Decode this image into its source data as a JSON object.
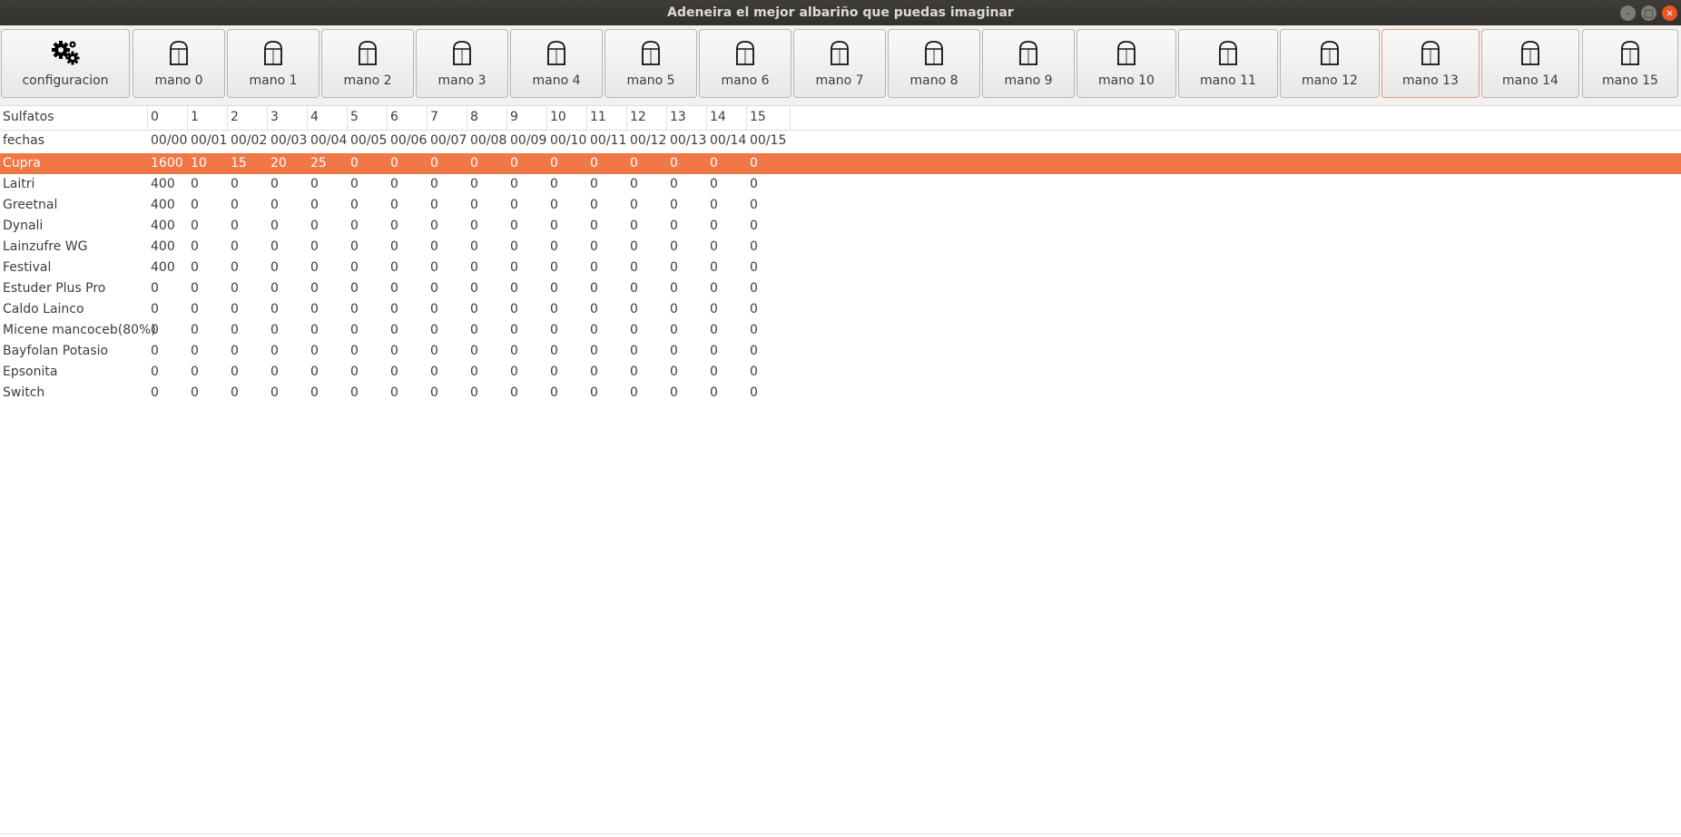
{
  "window": {
    "title": "Adeneira el mejor albariño que puedas imaginar",
    "minimize_glyph": "–",
    "maximize_glyph": "□",
    "close_glyph": "×"
  },
  "toolbar": {
    "config": {
      "label": "configuracion",
      "icon": "gears-icon"
    },
    "manos": [
      {
        "label": "mano 0"
      },
      {
        "label": "mano 1"
      },
      {
        "label": "mano 2"
      },
      {
        "label": "mano 3"
      },
      {
        "label": "mano 4"
      },
      {
        "label": "mano 5"
      },
      {
        "label": "mano 6"
      },
      {
        "label": "mano 7"
      },
      {
        "label": "mano 8"
      },
      {
        "label": "mano 9"
      },
      {
        "label": "mano 10"
      },
      {
        "label": "mano 11"
      },
      {
        "label": "mano 12"
      },
      {
        "label": "mano 13"
      },
      {
        "label": "mano 14"
      },
      {
        "label": "mano 15"
      }
    ],
    "mano_icon": "barn-door-icon",
    "highlighted_index": 13
  },
  "table": {
    "header_label": "Sulfatos",
    "columns": [
      "0",
      "1",
      "2",
      "3",
      "4",
      "5",
      "6",
      "7",
      "8",
      "9",
      "10",
      "11",
      "12",
      "13",
      "14",
      "15"
    ],
    "dates_label": "fechas",
    "dates": [
      "00/00",
      "00/01",
      "00/02",
      "00/03",
      "00/04",
      "00/05",
      "00/06",
      "00/07",
      "00/08",
      "00/09",
      "00/10",
      "00/11",
      "00/12",
      "00/13",
      "00/14",
      "00/15"
    ],
    "selected_row": 0,
    "selected_color": "#f07746",
    "rows": [
      {
        "name": "Cupra",
        "values": [
          "1600",
          "10",
          "15",
          "20",
          "25",
          "0",
          "0",
          "0",
          "0",
          "0",
          "0",
          "0",
          "0",
          "0",
          "0",
          "0"
        ]
      },
      {
        "name": "Laitri",
        "values": [
          "400",
          "0",
          "0",
          "0",
          "0",
          "0",
          "0",
          "0",
          "0",
          "0",
          "0",
          "0",
          "0",
          "0",
          "0",
          "0"
        ]
      },
      {
        "name": "Greetnal",
        "values": [
          "400",
          "0",
          "0",
          "0",
          "0",
          "0",
          "0",
          "0",
          "0",
          "0",
          "0",
          "0",
          "0",
          "0",
          "0",
          "0"
        ]
      },
      {
        "name": "Dynali",
        "values": [
          "400",
          "0",
          "0",
          "0",
          "0",
          "0",
          "0",
          "0",
          "0",
          "0",
          "0",
          "0",
          "0",
          "0",
          "0",
          "0"
        ]
      },
      {
        "name": "Lainzufre WG",
        "values": [
          "400",
          "0",
          "0",
          "0",
          "0",
          "0",
          "0",
          "0",
          "0",
          "0",
          "0",
          "0",
          "0",
          "0",
          "0",
          "0"
        ]
      },
      {
        "name": "Festival",
        "values": [
          "400",
          "0",
          "0",
          "0",
          "0",
          "0",
          "0",
          "0",
          "0",
          "0",
          "0",
          "0",
          "0",
          "0",
          "0",
          "0"
        ]
      },
      {
        "name": "Estuder Plus Pro",
        "values": [
          "0",
          "0",
          "0",
          "0",
          "0",
          "0",
          "0",
          "0",
          "0",
          "0",
          "0",
          "0",
          "0",
          "0",
          "0",
          "0"
        ]
      },
      {
        "name": "Caldo Lainco",
        "values": [
          "0",
          "0",
          "0",
          "0",
          "0",
          "0",
          "0",
          "0",
          "0",
          "0",
          "0",
          "0",
          "0",
          "0",
          "0",
          "0"
        ]
      },
      {
        "name": "Micene mancoceb(80%)",
        "values": [
          "0",
          "0",
          "0",
          "0",
          "0",
          "0",
          "0",
          "0",
          "0",
          "0",
          "0",
          "0",
          "0",
          "0",
          "0",
          "0"
        ]
      },
      {
        "name": "Bayfolan Potasio",
        "values": [
          "0",
          "0",
          "0",
          "0",
          "0",
          "0",
          "0",
          "0",
          "0",
          "0",
          "0",
          "0",
          "0",
          "0",
          "0",
          "0"
        ]
      },
      {
        "name": "Epsonita",
        "values": [
          "0",
          "0",
          "0",
          "0",
          "0",
          "0",
          "0",
          "0",
          "0",
          "0",
          "0",
          "0",
          "0",
          "0",
          "0",
          "0"
        ]
      },
      {
        "name": "Switch",
        "values": [
          "0",
          "0",
          "0",
          "0",
          "0",
          "0",
          "0",
          "0",
          "0",
          "0",
          "0",
          "0",
          "0",
          "0",
          "0",
          "0"
        ]
      }
    ]
  }
}
